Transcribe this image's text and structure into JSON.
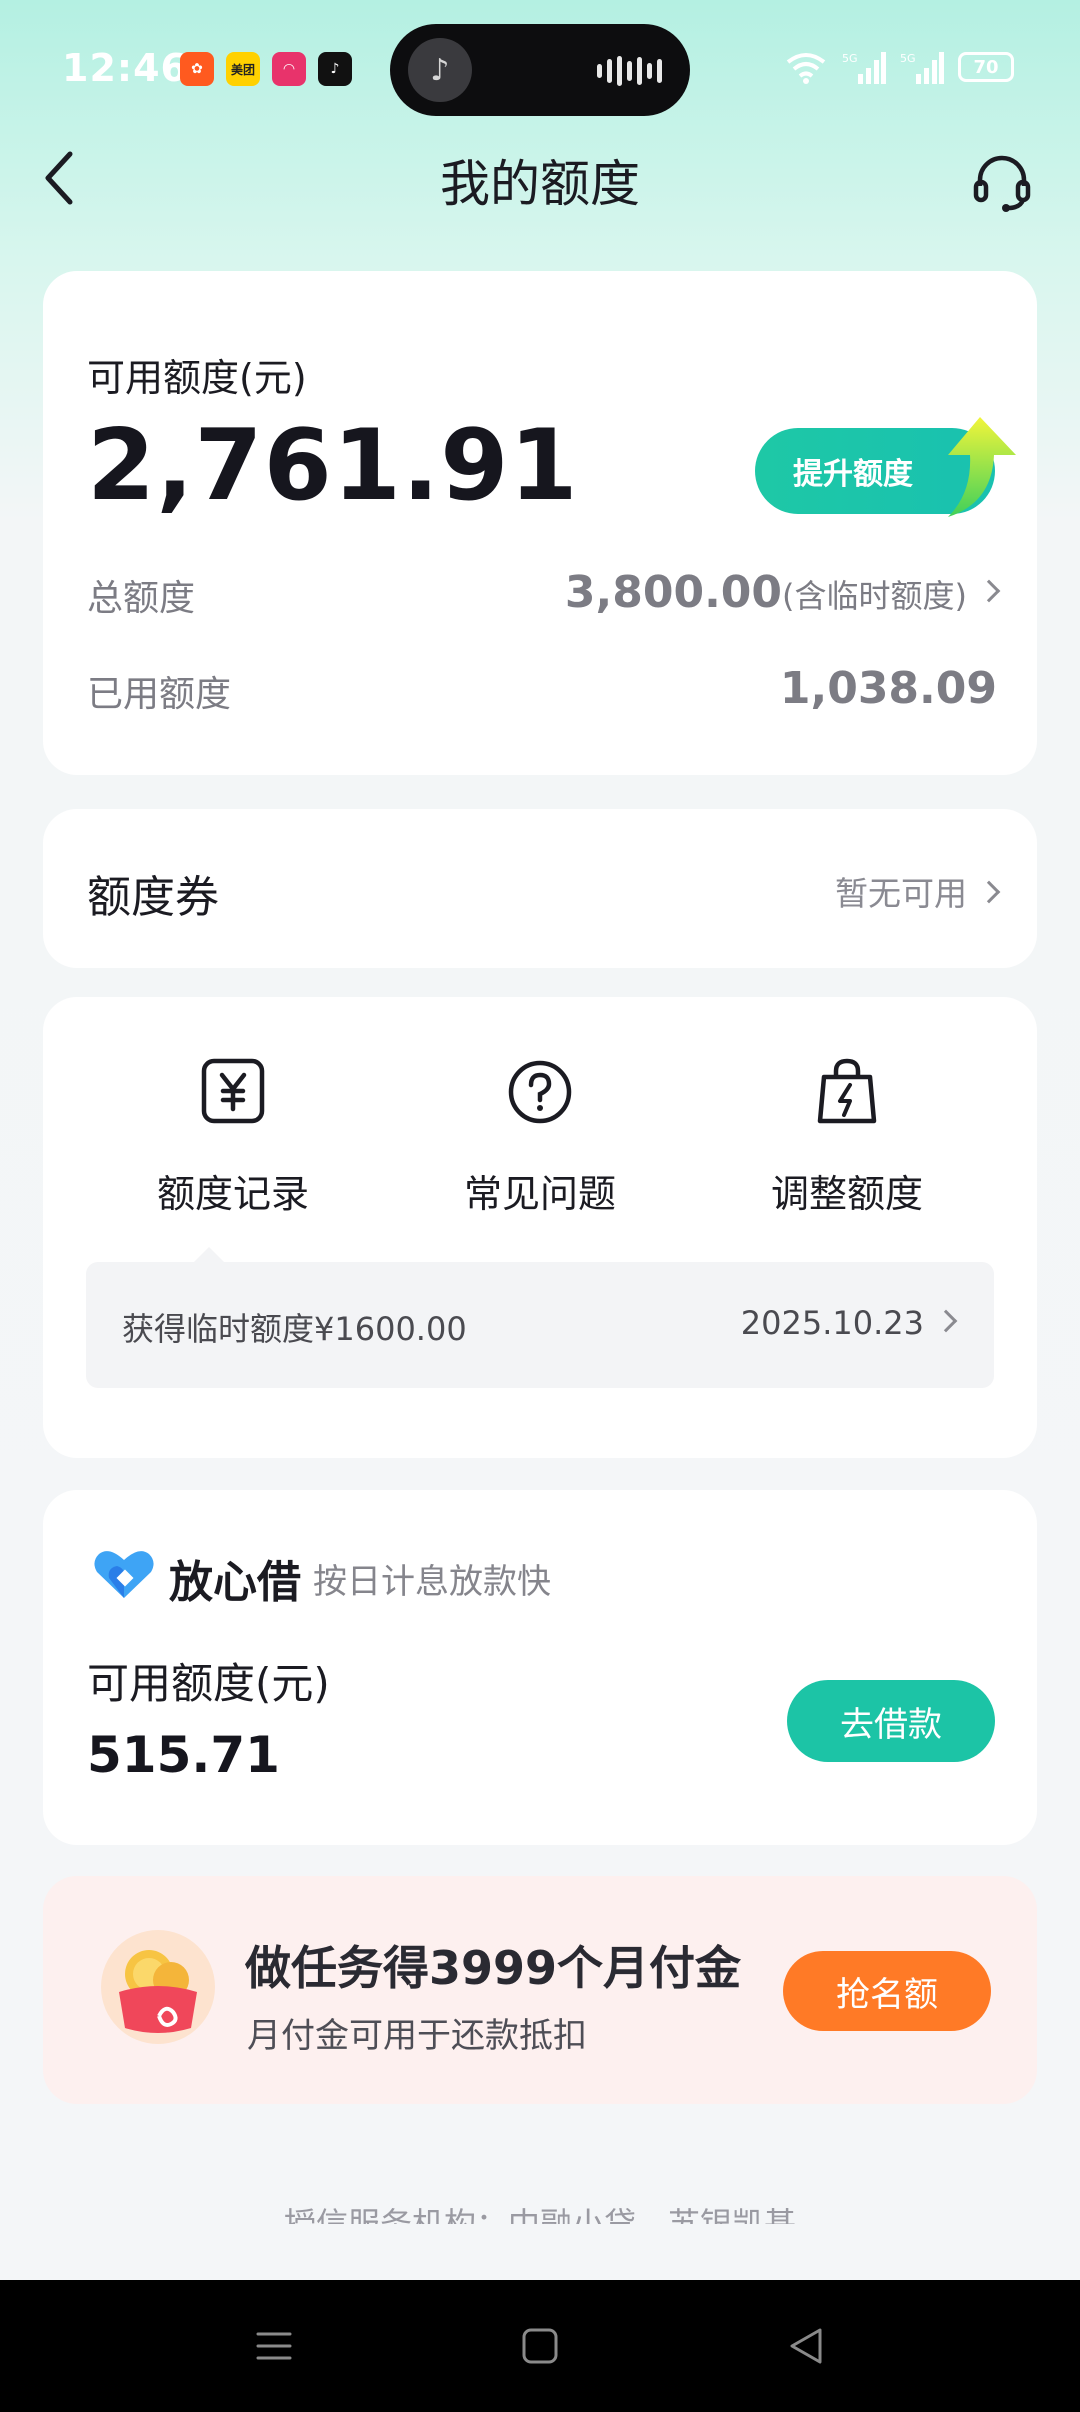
{
  "status_bar": {
    "time": "12:46",
    "apps": [
      {
        "name": "qq-browser-icon",
        "text": "",
        "color": "#ff5a1f"
      },
      {
        "name": "meituan-icon",
        "text": "美团",
        "color": "#ffd100"
      },
      {
        "name": "app-red-icon",
        "text": "",
        "color": "#e8336b"
      },
      {
        "name": "tiktok-icon",
        "text": "",
        "color": "#111111"
      }
    ],
    "battery": "70"
  },
  "header": {
    "title": "我的额度"
  },
  "limit_card": {
    "available_label": "可用额度(元)",
    "available_value": "2,761.91",
    "boost_button": "提升额度",
    "total_label": "总额度",
    "total_value": "3,800.00",
    "total_note": "(含临时额度)",
    "used_label": "已用额度",
    "used_value": "1,038.09"
  },
  "coupon_card": {
    "title": "额度券",
    "status": "暂无可用"
  },
  "shortcuts": {
    "items": [
      {
        "label": "额度记录",
        "icon": "yuan-record-icon"
      },
      {
        "label": "常见问题",
        "icon": "question-icon"
      },
      {
        "label": "调整额度",
        "icon": "bag-bolt-icon"
      }
    ],
    "record": {
      "text": "获得临时额度¥1600.00",
      "date": "2025.10.23"
    }
  },
  "loan_card": {
    "brand": "放心借",
    "brand_sub": "按日计息放款快",
    "available_label": "可用额度(元)",
    "available_value": "515.71",
    "button": "去借款"
  },
  "promo_card": {
    "title": "做任务得3999个月付金",
    "subtitle": "月付金可用于还款抵扣",
    "button": "抢名额"
  },
  "footer": {
    "text": "授信服务机构：中融小贷、苏银凯基"
  },
  "colors": {
    "accent": "#1cc4a6",
    "promo": "#ff7a26"
  }
}
